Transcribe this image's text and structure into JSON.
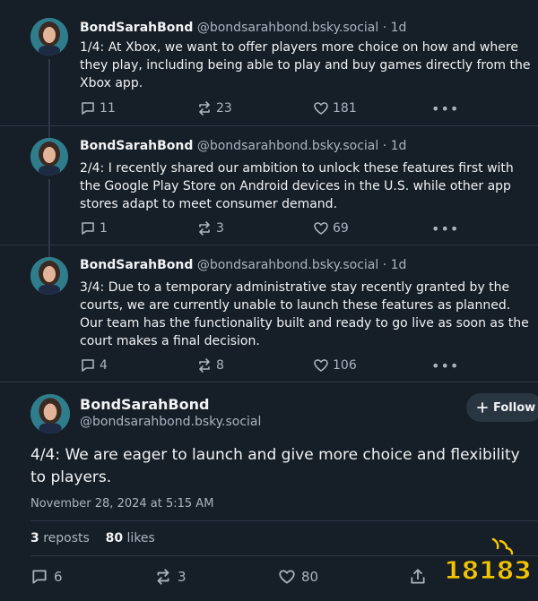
{
  "posts": [
    {
      "name": "BondSarahBond",
      "handle": "@bondsarahbond.bsky.social",
      "dot": "·",
      "time": "1d",
      "text": "1/4: At Xbox, we want to offer players more choice on how and where they play, including being able to play and buy games directly from the Xbox app.",
      "replies": "11",
      "reposts": "23",
      "likes": "181",
      "more": "•••"
    },
    {
      "name": "BondSarahBond",
      "handle": "@bondsarahbond.bsky.social",
      "dot": "·",
      "time": "1d",
      "text": "2/4: I recently shared our ambition to unlock these features first with the Google Play Store on Android devices in the U.S. while other app stores adapt to meet consumer demand.",
      "replies": "1",
      "reposts": "3",
      "likes": "69",
      "more": "•••"
    },
    {
      "name": "BondSarahBond",
      "handle": "@bondsarahbond.bsky.social",
      "dot": "·",
      "time": "1d",
      "text": "3/4: Due to a temporary administrative stay recently granted by the courts, we are currently unable to launch these features as planned. Our team has the functionality built and ready to go live as soon as the court makes a final decision.",
      "replies": "4",
      "reposts": "8",
      "likes": "106",
      "more": "•••"
    }
  ],
  "main": {
    "name": "BondSarahBond",
    "handle": "@bondsarahbond.bsky.social",
    "follow_label": "Follow",
    "text": "4/4: We are eager to launch and give more choice and flexibility to players.",
    "date": "November 28, 2024 at 5:15 AM",
    "reposts_count": "3",
    "reposts_label": "reposts",
    "likes_count": "80",
    "likes_label": "likes",
    "replies": "6",
    "reposts": "3",
    "likes": "80"
  },
  "watermark": {
    "text": "18183"
  },
  "colors": {
    "background": "#161e27",
    "text": "#f1f3f5",
    "muted": "#aab4bf",
    "divider": "#2e3a47",
    "avatar_bg": "#2f7d8c",
    "watermark": "#f5c400"
  },
  "icons": [
    "reply-icon",
    "repost-icon",
    "like-icon",
    "more-icon",
    "plus-icon",
    "share-icon"
  ]
}
